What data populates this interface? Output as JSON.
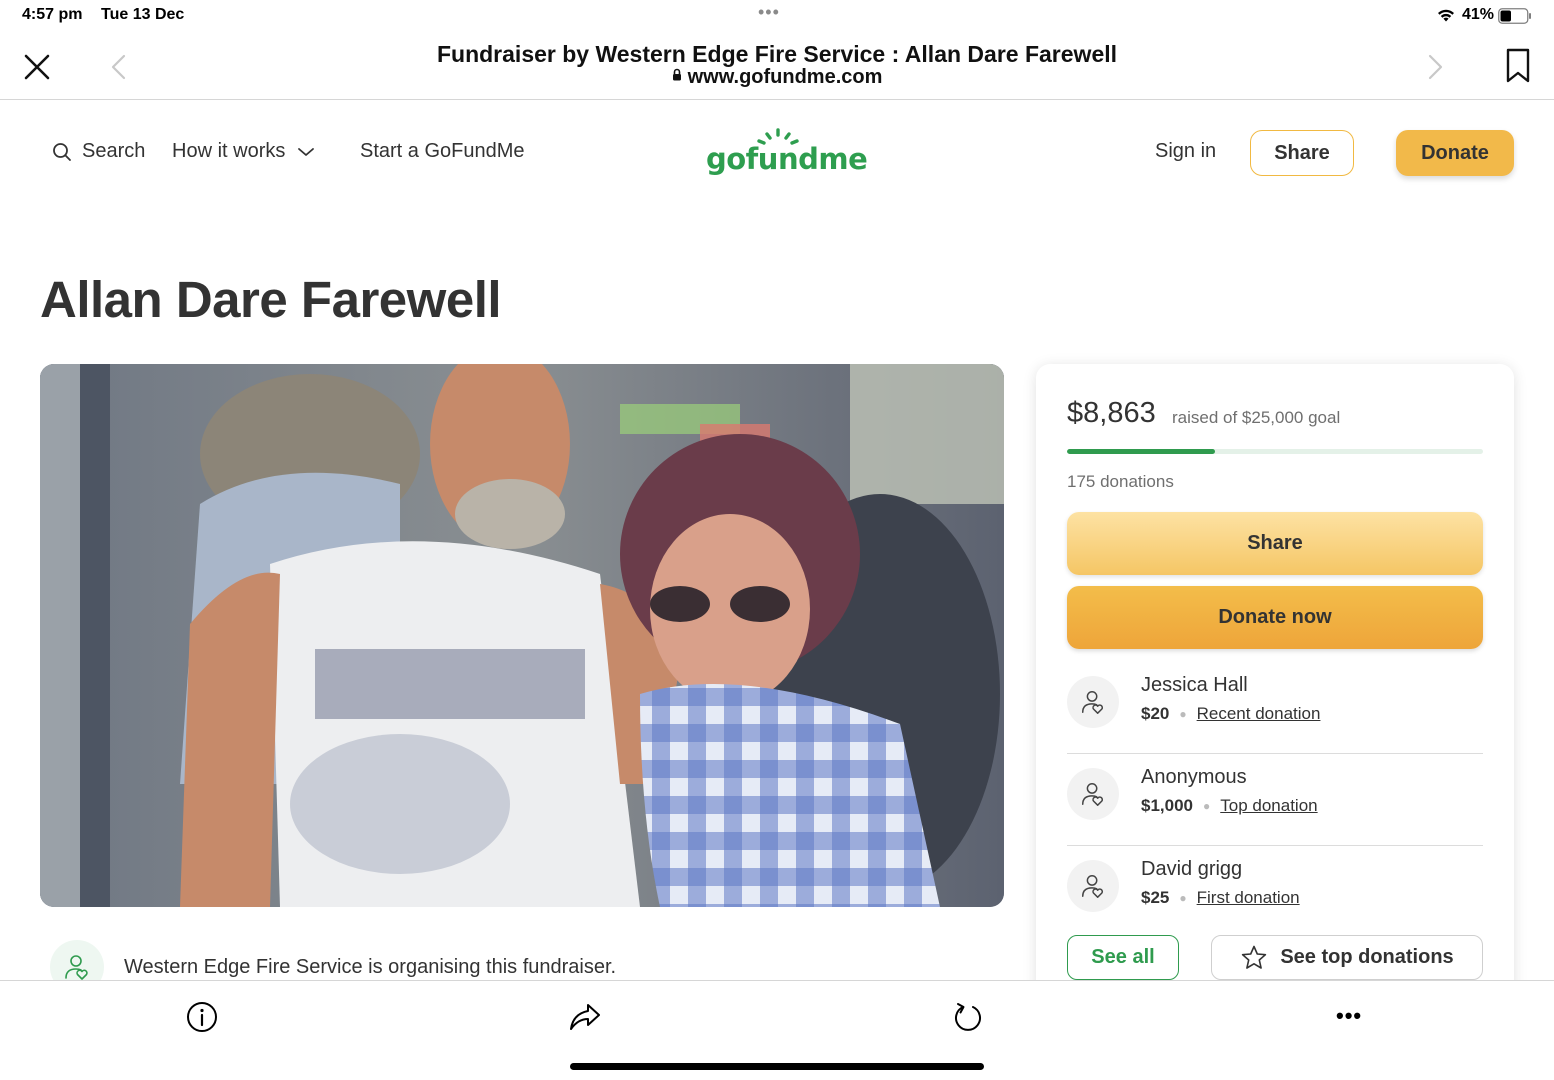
{
  "status_bar": {
    "time": "4:57 pm",
    "date": "Tue 13 Dec",
    "dots": "•••",
    "battery_percent": "41%",
    "battery_level": 0.41
  },
  "browser": {
    "page_title": "Fundraiser by Western Edge Fire Service : Allan Dare Farewell",
    "url": "www.gofundme.com"
  },
  "nav": {
    "search_label": "Search",
    "how_label": "How it works",
    "start_label": "Start a GoFundMe",
    "logo_text": "gofundme",
    "signin_label": "Sign in",
    "share_label": "Share",
    "donate_label": "Donate"
  },
  "campaign": {
    "title": "Allan Dare Farewell",
    "organiser_text": "Western Edge Fire Service is organising this fundraiser."
  },
  "donation_card": {
    "raised": "$8,863",
    "goal_text": "raised of $25,000 goal",
    "progress_fraction": 0.355,
    "donations_count": "175 donations",
    "share_label": "Share",
    "donate_label": "Donate now",
    "donors": [
      {
        "name": "Jessica Hall",
        "amount": "$20",
        "tag": "Recent donation"
      },
      {
        "name": "Anonymous",
        "amount": "$1,000",
        "tag": "Top donation"
      },
      {
        "name": "David grigg",
        "amount": "$25",
        "tag": "First donation"
      }
    ],
    "see_all_label": "See all",
    "see_top_label": "See top donations"
  },
  "toolbar": {
    "more_label": "•••"
  },
  "colors": {
    "brand_green": "#2f9b4e",
    "donate_yellow": "#f2b94a"
  }
}
